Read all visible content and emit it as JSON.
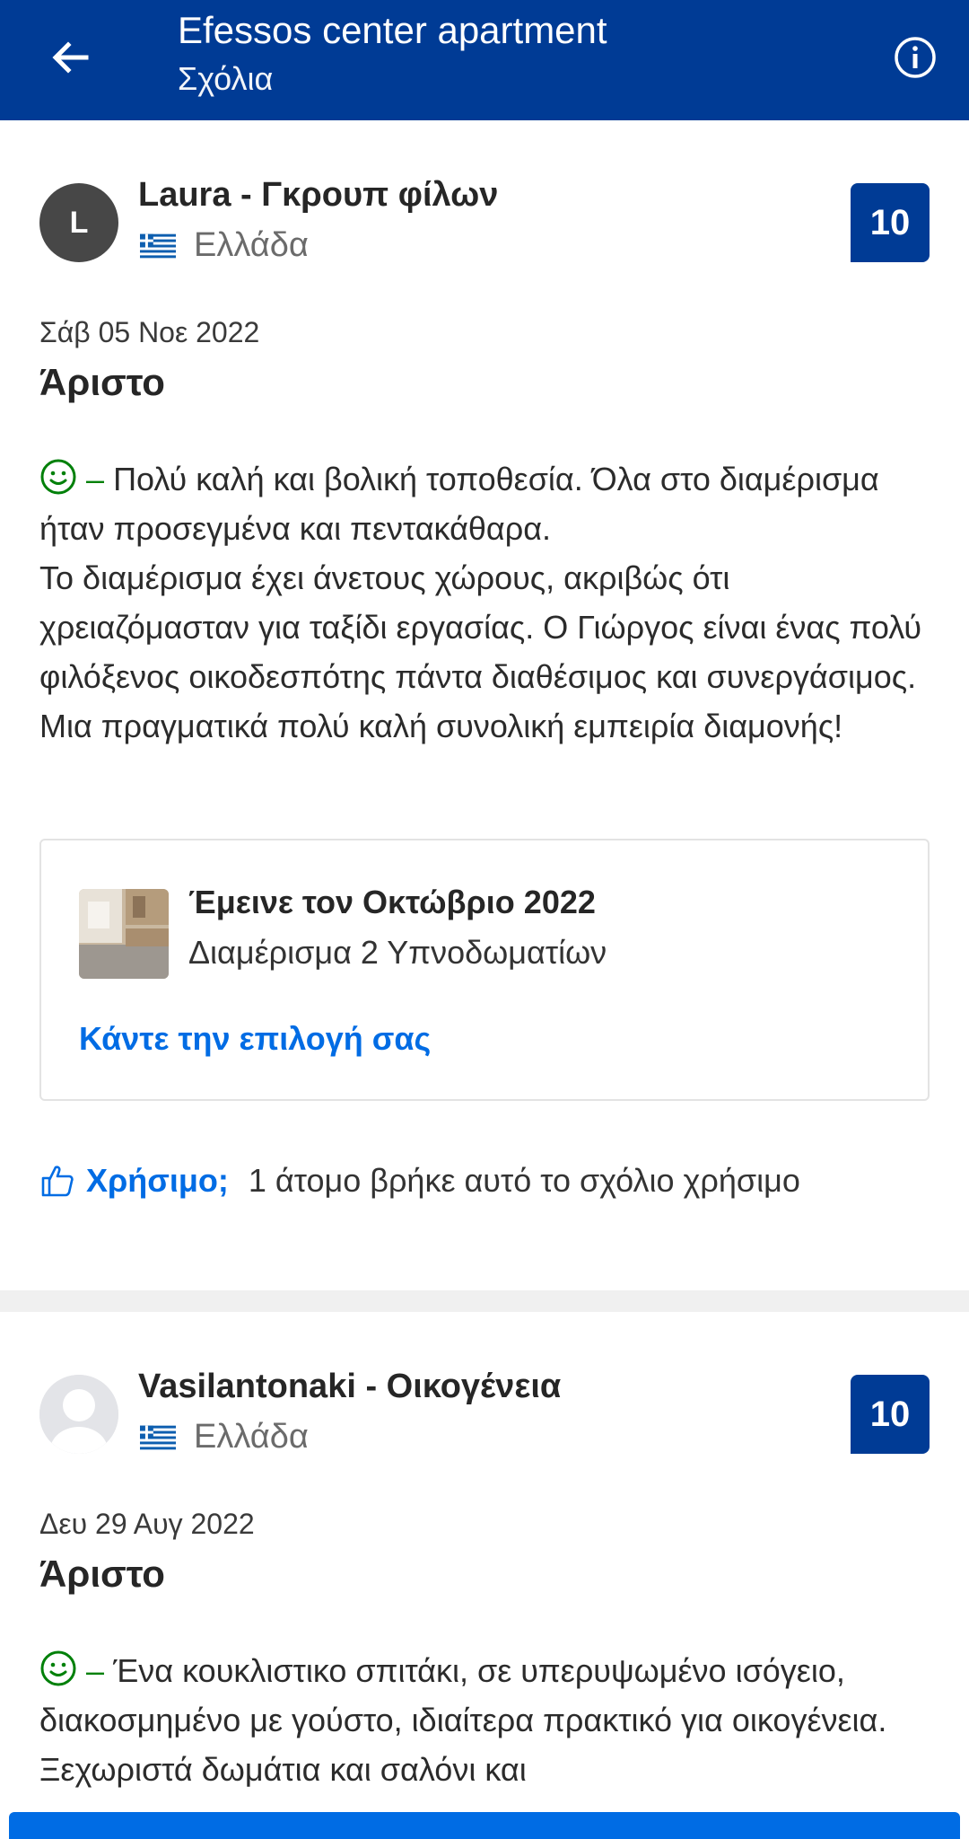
{
  "header": {
    "title": "Efessos center apartment",
    "subtitle": "Σχόλια",
    "back_icon": "arrow-left-icon",
    "info_icon": "info-icon"
  },
  "colors": {
    "brand": "#003b95",
    "link": "#006ce4",
    "positive": "#008009"
  },
  "reviews": [
    {
      "avatar_letter": "L",
      "name": "Laura - Γκρουπ φίλων",
      "country": "Ελλάδα",
      "score": "10",
      "date": "Σάβ 05 Νοε 2022",
      "verdict": "Άριστο",
      "positive_text": "Πολύ καλή και βολική τοποθεσία. Όλα στο διαμέρισμα ήταν προσεγμένα και πεντακάθαρα.",
      "positive_text_2": "Το διαμέρισμα έχει άνετους χώρους, ακριβώς ότι χρειαζόμασταν για ταξίδι εργασίας. Ο Γιώργος είναι ένας πολύ φιλόξενος οικοδεσπότης πάντα διαθέσιμος και  συνεργάσιμος. Μια πραγματικά πολύ καλή συνολική εμπειρία διαμονής!",
      "stay": {
        "stayed": "Έμεινε τον Οκτώβριο 2022",
        "room": "Διαμέρισμα 2 Υπνοδωματίων",
        "link": "Κάντε την επιλογή σας"
      },
      "helpful_label": "Χρήσιμο;",
      "helpful_count": "1 άτομο βρήκε αυτό το σχόλιο χρήσιμο"
    },
    {
      "name": "Vasilantonaki - Οικογένεια",
      "country": "Ελλάδα",
      "score": "10",
      "date": "Δευ 29 Αυγ 2022",
      "verdict": "Άριστο",
      "positive_text": "Ένα κουκλιστικο σπιτάκι, σε υπερυψωμένο ισόγειο,  διακοσμημένο με γούστο, ιδιαίτερα πρακτικό για οικογένεια. Ξεχωριστά δωμάτια και σαλόνι και"
    }
  ],
  "dash": "–"
}
